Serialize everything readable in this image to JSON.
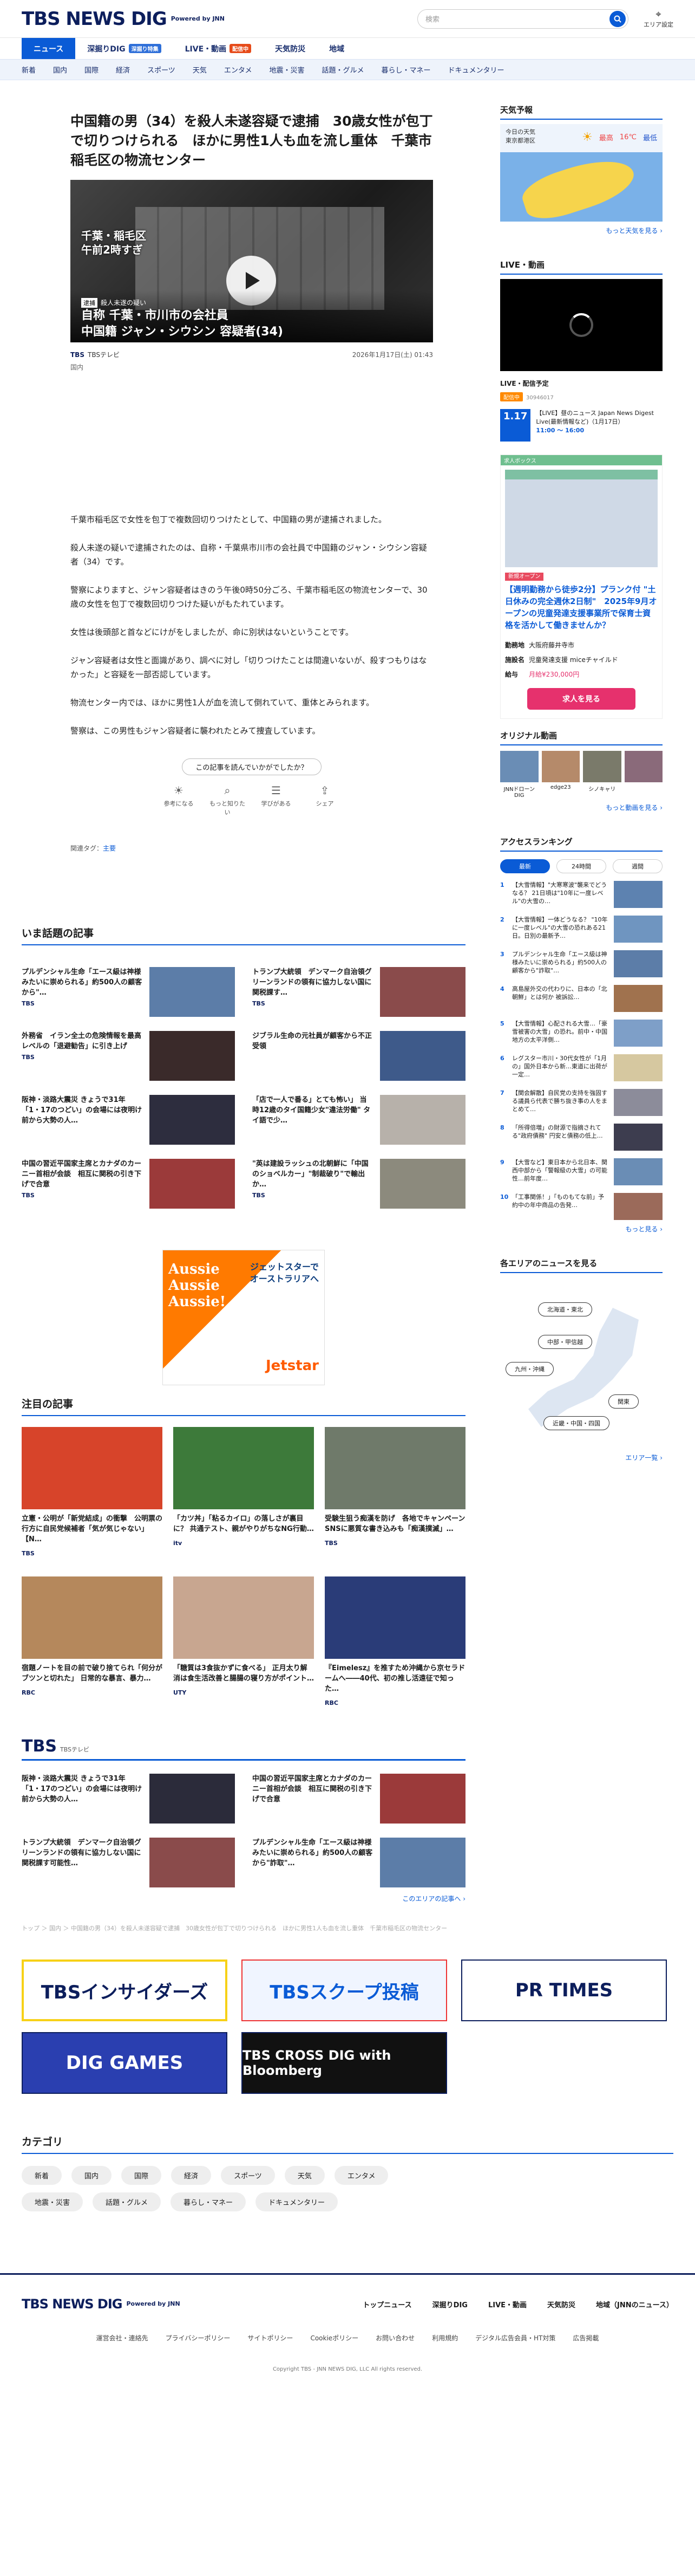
{
  "header": {
    "logo": "TBS NEWS DIG",
    "powered": "Powered by JNN",
    "search_placeholder": "検索",
    "area_label": "エリア設定"
  },
  "nav_primary": [
    {
      "label": "ニュース"
    },
    {
      "label": "深掘りDIG",
      "badge": "深掘り特集"
    },
    {
      "label": "LIVE・動画",
      "badge": "配信中"
    },
    {
      "label": "天気防災"
    },
    {
      "label": "地域"
    }
  ],
  "nav_secondary": [
    "新着",
    "国内",
    "国際",
    "経済",
    "スポーツ",
    "天気",
    "エンタメ",
    "地震・災害",
    "話題・グルメ",
    "暮らし・マネー",
    "ドキュメンタリー"
  ],
  "article": {
    "title": "中国籍の男（34）を殺人未遂容疑で逮捕　30歳女性が包丁で切りつけられる　ほかに男性1人も血を流し重体　千葉市稲毛区の物流センター",
    "video_caption_top": "千葉・稲毛区\n午前2時すぎ",
    "video_tag": "逮捕",
    "video_tag_sub": "殺人未遂の疑い",
    "video_line1": "自称 千葉・市川市の会社員",
    "video_line2": "中国籍 ジャン・シウシン 容疑者(34)",
    "source": "TBS",
    "source_name": "TBSテレビ",
    "datetime": "2026年1月17日(土) 01:43",
    "category": "国内",
    "paragraphs": [
      "千葉市稲毛区で女性を包丁で複数回切りつけたとして、中国籍の男が逮捕されました。",
      "殺人未遂の疑いで逮捕されたのは、自称・千葉県市川市の会社員で中国籍のジャン・シウシン容疑者（34）です。",
      "警察によりますと、ジャン容疑者はきのう午後0時50分ごろ、千葉市稲毛区の物流センターで、30歳の女性を包丁で複数回切りつけた疑いがもたれています。",
      "女性は後頭部と首などにけがをしましたが、命に別状はないということです。",
      "ジャン容疑者は女性と面識があり、調べに対し「切りつけたことは間違いないが、殺すつもりはなかった」と容疑を一部否認しています。",
      "物流センター内では、ほかに男性1人が血を流して倒れていて、重体とみられます。",
      "警察は、この男性もジャン容疑者に襲われたとみて捜査しています。"
    ],
    "reaction_question": "この記事を読んでいかがでしたか？",
    "reactions": [
      "参考になる",
      "もっと知りたい",
      "学びがある",
      "シェア"
    ],
    "tags_label": "関連タグ：",
    "tag": "主要"
  },
  "trending": {
    "title": "いま話題の記事",
    "items": [
      {
        "title": "プルデンシャル生命「エース級は神様みたいに崇められる」約500人の顧客から\"…",
        "src": "TBS",
        "time": ""
      },
      {
        "title": "トランプ大統領　デンマーク自治領グリーンランドの領有に協力しない国に関税課す…",
        "src": "TBS",
        "time": ""
      },
      {
        "title": "外務省　イラン全土の危険情報を最高レベルの「退避勧告」に引き上げ",
        "src": "TBS",
        "time": ""
      },
      {
        "title": "ジブラル生命の元社員が顧客から不正受領",
        "src": "",
        "time": ""
      },
      {
        "title": "阪神・淡路大震災 きょうで31年「1・17のつどい」の会場には夜明け前から大勢の人…",
        "src": "",
        "time": ""
      },
      {
        "title": "「店で一人で番る」とても怖い」 当時12歳のタイ国籍少女\"違法労働\" タイ語で少…",
        "src": "",
        "time": ""
      },
      {
        "title": "中国の習近平国家主席とカナダのカーニー首相が会談　相互に関税の引き下げで合意",
        "src": "TBS",
        "time": ""
      },
      {
        "title": "\"英は建設ラッシュの北朝鮮に「中国のショベルカー」\"制裁破り\"で輸出か…",
        "src": "TBS",
        "time": ""
      }
    ]
  },
  "ad": {
    "l1": "Aussie",
    "l2": "Aussie",
    "l3": "Aussie!",
    "r1": "ジェットスターで",
    "r2": "オーストラリアへ",
    "brand": "Jetstar"
  },
  "featured": {
    "title": "注目の記事",
    "items": [
      {
        "title": "立憲・公明が「新党結成」の衝撃　公明票の行方に自民党候補者「気が気じゃない」【N…",
        "src": "TBS",
        "time": ""
      },
      {
        "title": "「カツ丼」「粘るカイロ」の落しさが裏目に？ 共通テスト、親がやりがちなNG行動…",
        "src": "itv",
        "time": ""
      },
      {
        "title": "受験生狙う痴漢を防げ　各地でキャンペーン SNSに悪質な書き込みも「痴漢撲滅」…",
        "src": "TBS",
        "time": ""
      },
      {
        "title": "宿題ノートを目の前で破り捨てられ「何分がブツンと切れた」 日常的な暴言、暴力…",
        "src": "RBC",
        "time": ""
      },
      {
        "title": "「糖質は3食抜かずに食べる」 正月太り解消は食生活改善と腸腸の寝り方がポイント…",
        "src": "UTY",
        "time": ""
      },
      {
        "title": "『Eimelesz』を推すため沖縄から京セラドームへ――40代、初の推し活遠征で知った…",
        "src": "RBC",
        "time": ""
      }
    ]
  },
  "tbs_box": {
    "title": "TBS",
    "sub": "TBSテレビ",
    "items": [
      {
        "title": "阪神・淡路大震災 きょうで31年「1・17のつどい」の会場には夜明け前から大勢の人…",
        "time": ""
      },
      {
        "title": "中国の習近平国家主席とカナダのカーニー首相が会談　相互に関税の引き下げで合意",
        "time": ""
      },
      {
        "title": "トランプ大統領　デンマーク自治領グリーンランドの領有に協力しない国に関税課す可能性…",
        "time": ""
      },
      {
        "title": "プルデンシャル生命「エース級は神様みたいに崇められる」約500人の顧客から\"詐取\"…",
        "time": ""
      }
    ],
    "more": "このエリアの記事へ ›"
  },
  "breadcrumb": "トップ ＞ 国内 ＞ 中国籍の男（34）を殺人未遂容疑で逮捕　30歳女性が包丁で切りつけられる　ほかに男性1人も血を流し重体　千葉市稲毛区の物流センター",
  "banners": [
    "TBSインサイダーズ",
    "TBSスクープ投稿",
    "PR TIMES",
    "DIG GAMES",
    "TBS CROSS DIG with Bloomberg"
  ],
  "categories": {
    "title": "カテゴリ",
    "items": [
      "新着",
      "国内",
      "国際",
      "経済",
      "スポーツ",
      "天気",
      "エンタメ",
      "地震・災害",
      "話題・グルメ",
      "暮らし・マネー",
      "ドキュメンタリー"
    ]
  },
  "footer": {
    "links1": [
      "トップニュース",
      "深掘りDIG",
      "LIVE・動画",
      "天気防災",
      "地域（JNNのニュース）"
    ],
    "links2": [
      "運営会社・連絡先",
      "プライバシーポリシー",
      "サイトポリシー",
      "Cookieポリシー",
      "お問い合わせ",
      "利用規約",
      "デジタル広告会員・HT対策",
      "広告掲載"
    ],
    "copyright": "Copyright TBS - JNN NEWS DIG, LLC All rights reserved."
  },
  "sidebar": {
    "weather": {
      "title": "天気予報",
      "today": "今日の天気",
      "place": "東京都港区",
      "high": "最高",
      "high_v": "16℃",
      "low": "最低",
      "more": "もっと天気を見る ›"
    },
    "live": {
      "title": "LIVE・動画",
      "sched_label": "LIVE・配信予定",
      "on_air": "配信中",
      "on_air_sub": "30946017",
      "date": "1.17",
      "s_title": "【LIVE】昼のニュース Japan News Digest Live(最新情報など)（1月17日）",
      "s_time": "11:00 〜 16:00"
    },
    "job": {
      "banner": "求人ボックス",
      "tag": "新規オープン",
      "title": "【週明勤務から徒歩2分】プランク付 \"土日休みの完全週休2日制\"　2025年9月オープンの児童発達支援事業所で保育士資格を活かして働きませんか？",
      "r1k": "勤務地",
      "r1v": "大阪府藤井寺市",
      "r2k": "施設名",
      "r2v": "児童発達支援 miceチャイルド",
      "r3k": "給与",
      "r3v": "月給¥230,000円",
      "btn": "求人を見る"
    },
    "original": {
      "title": "オリジナル動画",
      "items": [
        "JNNドローン DIG",
        "edge23",
        "シノキャリ",
        ""
      ],
      "more": "もっと動画を見る ›"
    },
    "ranking": {
      "title": "アクセスランキング",
      "tabs": [
        "最新",
        "24時間",
        "週間"
      ],
      "items": [
        {
          "n": "1",
          "t": "【大雪情報】\"大寒寒波\"襲来でどうなる？ 21日頃は\"10年に一度レベル\"の大雪の…"
        },
        {
          "n": "2",
          "t": "【大雪情報】一体どうなる？ \"10年に一度レベル\"の大雪の恐れある21日。日別の最新予…"
        },
        {
          "n": "3",
          "t": "プルデンシャル生命「エース級は神様みたいに崇められる」約500人の顧客から\"詐取\"…"
        },
        {
          "n": "4",
          "t": "高島屋外交の代わりに、日本の「北朝鮮」とは何か 被訴訟…"
        },
        {
          "n": "5",
          "t": "【大雪情報】心配される大雪…「豪雪被害の大雪」の恐れ。前中・中国地方の太平洋側…"
        },
        {
          "n": "6",
          "t": "レグスター市川・30代女性が「1月の」国外日本から新…東道に出荷が一定…"
        },
        {
          "n": "7",
          "t": "【関会解散】自民党の支持を強固する議員ら代表で勝ち抜き事の人をまとめて…"
        },
        {
          "n": "8",
          "t": "「所得倍増」の財源で指摘されてる\"政府債務\" 円安と債務の低上…"
        },
        {
          "n": "9",
          "t": "【大雪など】東日本から北日本、関西中部から「警報級の大雪」の可能性…前年度…"
        },
        {
          "n": "10",
          "t": "「工事関係！」「ものもてな前」予約中の年中商品の告発…"
        }
      ],
      "more": "もっと見る ›"
    },
    "areas": {
      "title": "各エリアのニュースを見る",
      "regions": [
        "北海道・東北",
        "中部・甲信越",
        "九州・沖縄",
        "関東",
        "近畿・中国・四国"
      ],
      "more": "エリア一覧 ›"
    }
  }
}
